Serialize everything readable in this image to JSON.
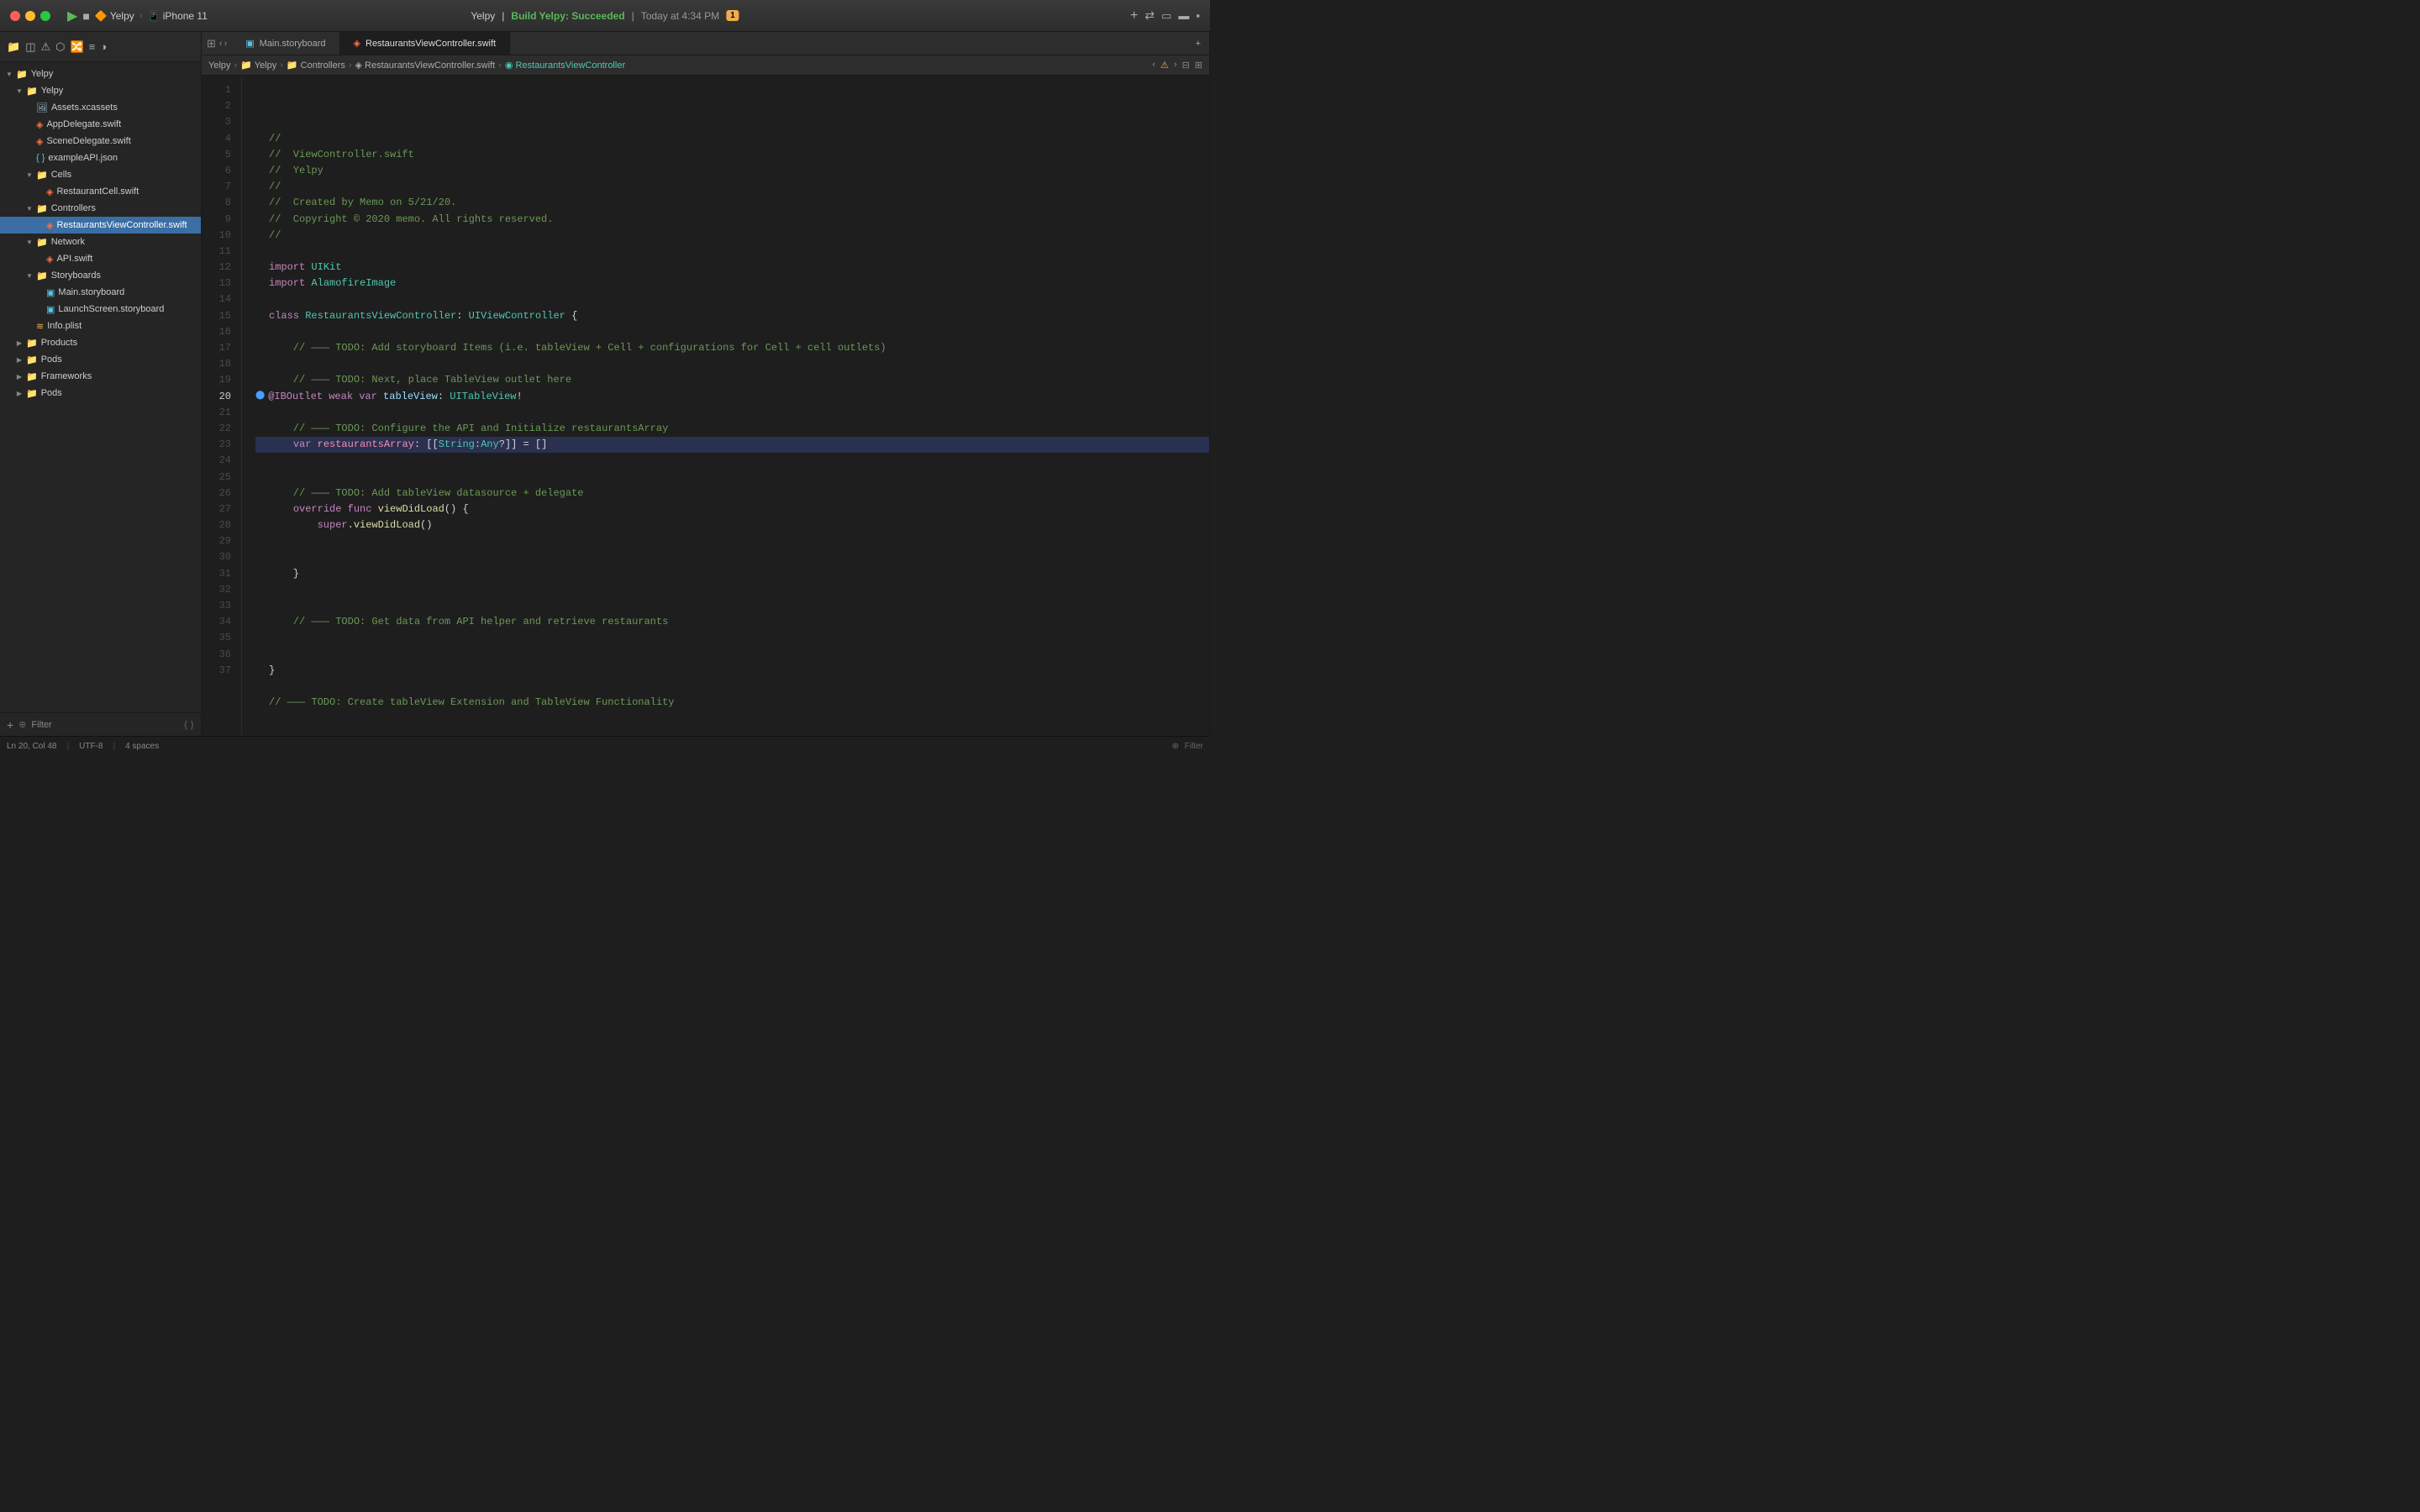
{
  "titleBar": {
    "project": "Yelpy",
    "device": "iPhone 11",
    "buildStatus": "Build Yelpy: Succeeded",
    "buildTime": "Today at 4:34 PM",
    "warningCount": "1"
  },
  "tabs": [
    {
      "label": "Main.storyboard",
      "active": false
    },
    {
      "label": "RestaurantsViewController.swift",
      "active": true
    }
  ],
  "breadcrumb": {
    "items": [
      "Yelpy",
      "Yelpy",
      "Controllers",
      "RestaurantsViewController.swift",
      "RestaurantsViewController"
    ]
  },
  "sidebar": {
    "tree": [
      {
        "id": "yelpy-root",
        "label": "Yelpy",
        "indent": 0,
        "type": "root",
        "open": true
      },
      {
        "id": "yelpy-group",
        "label": "Yelpy",
        "indent": 1,
        "type": "folder",
        "open": true
      },
      {
        "id": "assets",
        "label": "Assets.xcassets",
        "indent": 2,
        "type": "xcassets"
      },
      {
        "id": "appdelegate",
        "label": "AppDelegate.swift",
        "indent": 2,
        "type": "swift"
      },
      {
        "id": "scenedelegate",
        "label": "SceneDelegate.swift",
        "indent": 2,
        "type": "swift"
      },
      {
        "id": "exampleapi",
        "label": "exampleAPI.json",
        "indent": 2,
        "type": "json"
      },
      {
        "id": "cells",
        "label": "Cells",
        "indent": 2,
        "type": "folder",
        "open": true
      },
      {
        "id": "restaurantcell",
        "label": "RestaurantCell.swift",
        "indent": 3,
        "type": "swift"
      },
      {
        "id": "controllers",
        "label": "Controllers",
        "indent": 2,
        "type": "folder",
        "open": true
      },
      {
        "id": "restaurantsvc",
        "label": "RestaurantsViewController.swift",
        "indent": 3,
        "type": "swift",
        "selected": true
      },
      {
        "id": "network",
        "label": "Network",
        "indent": 2,
        "type": "folder",
        "open": true
      },
      {
        "id": "apiswift",
        "label": "API.swift",
        "indent": 3,
        "type": "swift"
      },
      {
        "id": "storyboards",
        "label": "Storyboards",
        "indent": 2,
        "type": "folder",
        "open": true
      },
      {
        "id": "mainstoryboard",
        "label": "Main.storyboard",
        "indent": 3,
        "type": "storyboard"
      },
      {
        "id": "launchscreen",
        "label": "LaunchScreen.storyboard",
        "indent": 3,
        "type": "storyboard"
      },
      {
        "id": "infoplist",
        "label": "Info.plist",
        "indent": 2,
        "type": "plist"
      },
      {
        "id": "products",
        "label": "Products",
        "indent": 1,
        "type": "folder",
        "open": false
      },
      {
        "id": "pods",
        "label": "Pods",
        "indent": 1,
        "type": "folder",
        "open": false
      },
      {
        "id": "frameworks",
        "label": "Frameworks",
        "indent": 1,
        "type": "folder",
        "open": false
      },
      {
        "id": "pods2",
        "label": "Pods",
        "indent": 1,
        "type": "folder",
        "open": false
      }
    ],
    "filterPlaceholder": "Filter",
    "filterLabel": "Filter"
  },
  "codeLines": [
    {
      "num": 1,
      "content": "//",
      "tokens": [
        {
          "t": "comment",
          "v": "//"
        }
      ]
    },
    {
      "num": 2,
      "content": "//  ViewController.swift",
      "tokens": [
        {
          "t": "comment",
          "v": "//  ViewController.swift"
        }
      ]
    },
    {
      "num": 3,
      "content": "//  Yelpy",
      "tokens": [
        {
          "t": "comment",
          "v": "//  Yelpy"
        }
      ]
    },
    {
      "num": 4,
      "content": "//",
      "tokens": [
        {
          "t": "comment",
          "v": "//"
        }
      ]
    },
    {
      "num": 5,
      "content": "//  Created by Memo on 5/21/20.",
      "tokens": [
        {
          "t": "comment",
          "v": "//  Created by Memo on 5/21/20."
        }
      ]
    },
    {
      "num": 6,
      "content": "//  Copyright © 2020 memo. All rights reserved.",
      "tokens": [
        {
          "t": "comment",
          "v": "//  Copyright © 2020 memo. All rights reserved."
        }
      ]
    },
    {
      "num": 7,
      "content": "//",
      "tokens": [
        {
          "t": "comment",
          "v": "//"
        }
      ]
    },
    {
      "num": 8,
      "content": "",
      "tokens": []
    },
    {
      "num": 9,
      "content": "import UIKit",
      "tokens": [
        {
          "t": "keyword",
          "v": "import"
        },
        {
          "t": "plain",
          "v": " "
        },
        {
          "t": "type",
          "v": "UIKit"
        }
      ]
    },
    {
      "num": 10,
      "content": "import AlamofireImage",
      "tokens": [
        {
          "t": "keyword",
          "v": "import"
        },
        {
          "t": "plain",
          "v": " "
        },
        {
          "t": "type",
          "v": "AlamofireImage"
        }
      ]
    },
    {
      "num": 11,
      "content": "",
      "tokens": []
    },
    {
      "num": 12,
      "content": "class RestaurantsViewController: UIViewController {",
      "tokens": [
        {
          "t": "keyword",
          "v": "class"
        },
        {
          "t": "plain",
          "v": " "
        },
        {
          "t": "type",
          "v": "RestaurantsViewController"
        },
        {
          "t": "plain",
          "v": ": "
        },
        {
          "t": "type",
          "v": "UIViewController"
        },
        {
          "t": "plain",
          "v": " {"
        }
      ]
    },
    {
      "num": 13,
      "content": "",
      "tokens": []
    },
    {
      "num": 14,
      "content": "    // ——— TODO: Add storyboard Items (i.e. tableView + Cell + configurations for Cell + cell outlets)",
      "tokens": [
        {
          "t": "comment",
          "v": "    // ——— TODO: Add storyboard Items (i.e. tableView + Cell + configurations for Cell + cell outlets)"
        }
      ]
    },
    {
      "num": 15,
      "content": "",
      "tokens": []
    },
    {
      "num": 16,
      "content": "    // ——— TODO: Next, place TableView outlet here",
      "tokens": [
        {
          "t": "comment",
          "v": "    // ——— TODO: Next, place TableView outlet here"
        }
      ]
    },
    {
      "num": 17,
      "content": "    @IBOutlet weak var tableView: UITableView!",
      "tokens": [
        {
          "t": "attr",
          "v": "@IBOutlet"
        },
        {
          "t": "plain",
          "v": " "
        },
        {
          "t": "keyword",
          "v": "weak"
        },
        {
          "t": "plain",
          "v": " "
        },
        {
          "t": "keyword",
          "v": "var"
        },
        {
          "t": "plain",
          "v": " "
        },
        {
          "t": "blue",
          "v": "tableView"
        },
        {
          "t": "plain",
          "v": ": "
        },
        {
          "t": "type",
          "v": "UITableView"
        },
        {
          "t": "plain",
          "v": "!"
        }
      ],
      "breakpoint": true
    },
    {
      "num": 18,
      "content": "",
      "tokens": []
    },
    {
      "num": 19,
      "content": "    // ——— TODO: Configure the API and Initialize restaurantsArray",
      "tokens": [
        {
          "t": "comment",
          "v": "    // ——— TODO: Configure the API and Initialize restaurantsArray"
        }
      ]
    },
    {
      "num": 20,
      "content": "    var restaurantsArray: [[String:Any?]] = []",
      "tokens": [
        {
          "t": "plain",
          "v": "    "
        },
        {
          "t": "keyword",
          "v": "var"
        },
        {
          "t": "plain",
          "v": " "
        },
        {
          "t": "pink",
          "v": "restaurantsArray"
        },
        {
          "t": "plain",
          "v": ": [["
        },
        {
          "t": "type",
          "v": "String"
        },
        {
          "t": "plain",
          "v": ":"
        },
        {
          "t": "type",
          "v": "Any"
        },
        {
          "t": "plain",
          "v": "?]] = []"
        }
      ],
      "selected": true
    },
    {
      "num": 21,
      "content": "",
      "tokens": []
    },
    {
      "num": 22,
      "content": "",
      "tokens": []
    },
    {
      "num": 23,
      "content": "    // ——— TODO: Add tableView datasource + delegate",
      "tokens": [
        {
          "t": "comment",
          "v": "    // ——— TODO: Add tableView datasource + delegate"
        }
      ]
    },
    {
      "num": 24,
      "content": "    override func viewDidLoad() {",
      "tokens": [
        {
          "t": "plain",
          "v": "    "
        },
        {
          "t": "keyword",
          "v": "override"
        },
        {
          "t": "plain",
          "v": " "
        },
        {
          "t": "keyword",
          "v": "func"
        },
        {
          "t": "plain",
          "v": " "
        },
        {
          "t": "func",
          "v": "viewDidLoad"
        },
        {
          "t": "plain",
          "v": "() {"
        }
      ]
    },
    {
      "num": 25,
      "content": "        super.viewDidLoad()",
      "tokens": [
        {
          "t": "plain",
          "v": "        "
        },
        {
          "t": "keyword",
          "v": "super"
        },
        {
          "t": "plain",
          "v": "."
        },
        {
          "t": "func",
          "v": "viewDidLoad"
        },
        {
          "t": "plain",
          "v": "()"
        }
      ]
    },
    {
      "num": 26,
      "content": "",
      "tokens": []
    },
    {
      "num": 27,
      "content": "",
      "tokens": []
    },
    {
      "num": 28,
      "content": "    }",
      "tokens": [
        {
          "t": "plain",
          "v": "    }"
        }
      ]
    },
    {
      "num": 29,
      "content": "",
      "tokens": []
    },
    {
      "num": 30,
      "content": "",
      "tokens": []
    },
    {
      "num": 31,
      "content": "    // ——— TODO: Get data from API helper and retrieve restaurants",
      "tokens": [
        {
          "t": "comment",
          "v": "    // ——— TODO: Get data from API helper and retrieve restaurants"
        }
      ]
    },
    {
      "num": 32,
      "content": "",
      "tokens": []
    },
    {
      "num": 33,
      "content": "",
      "tokens": []
    },
    {
      "num": 34,
      "content": "}",
      "tokens": [
        {
          "t": "plain",
          "v": "}"
        }
      ]
    },
    {
      "num": 35,
      "content": "",
      "tokens": []
    },
    {
      "num": 36,
      "content": "// ——— TODO: Create tableView Extension and TableView Functionality",
      "tokens": [
        {
          "t": "comment",
          "v": "// ——— TODO: Create tableView Extension and TableView Functionality"
        }
      ]
    },
    {
      "num": 37,
      "content": "",
      "tokens": []
    }
  ]
}
